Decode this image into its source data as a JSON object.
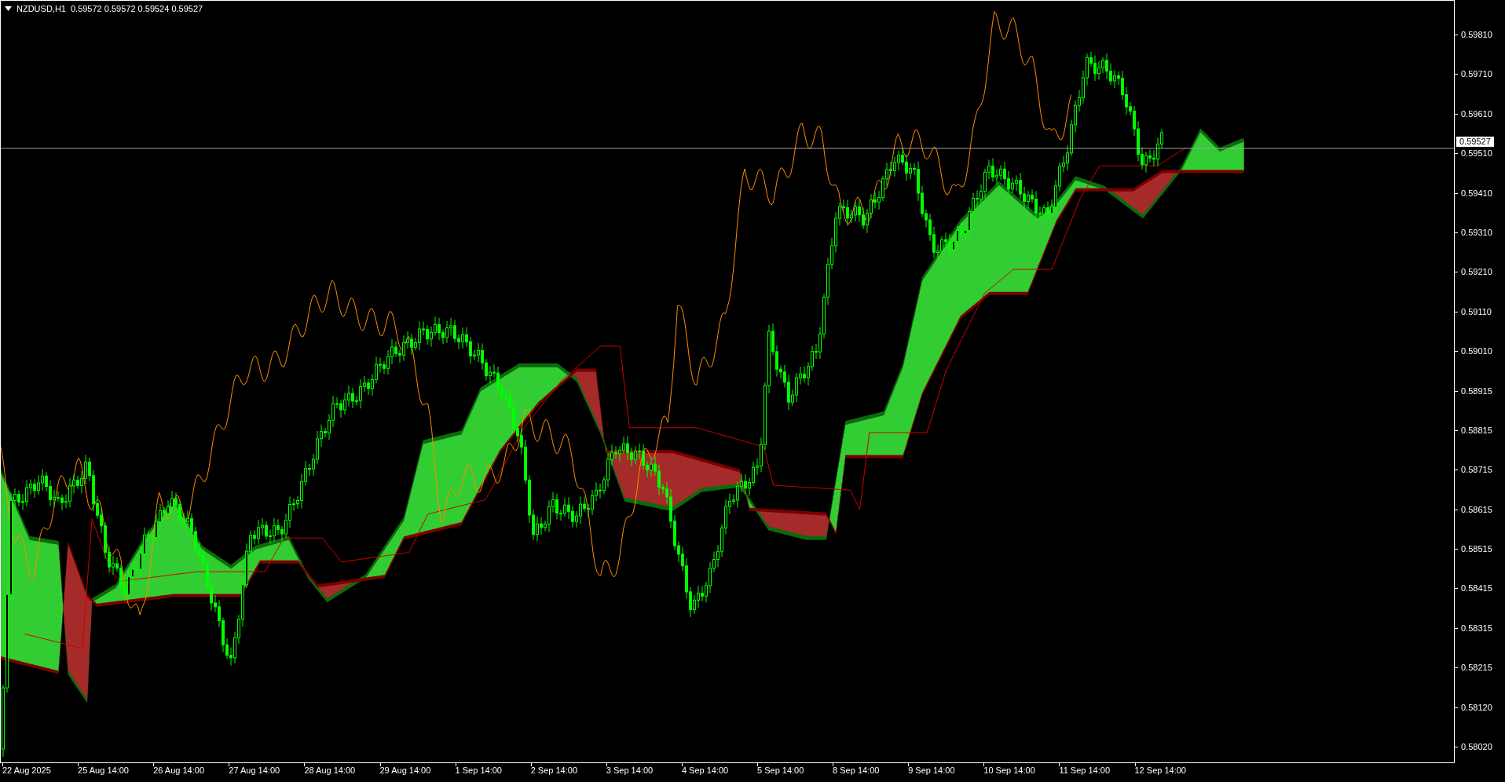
{
  "header": {
    "symbol": "NZDUSD,H1",
    "quotes": "0.59572 0.59572 0.59524 0.59527"
  },
  "price_axis": {
    "labels": [
      "0.59810",
      "0.59710",
      "0.59610",
      "0.59510",
      "0.59410",
      "0.59310",
      "0.59210",
      "0.59110",
      "0.59010",
      "0.58915",
      "0.58815",
      "0.58715",
      "0.58615",
      "0.58515",
      "0.58415",
      "0.58315",
      "0.58215",
      "0.58120",
      "0.58020"
    ],
    "current_price": "0.59527"
  },
  "time_axis": {
    "labels": [
      "22 Aug 2025",
      "25 Aug 14:00",
      "26 Aug 14:00",
      "27 Aug 14:00",
      "28 Aug 14:00",
      "29 Aug 14:00",
      "1 Sep 14:00",
      "2 Sep 14:00",
      "3 Sep 14:00",
      "4 Sep 14:00",
      "5 Sep 14:00",
      "8 Sep 14:00",
      "9 Sep 14:00",
      "10 Sep 14:00",
      "11 Sep 14:00",
      "12 Sep 14:00"
    ]
  }
}
